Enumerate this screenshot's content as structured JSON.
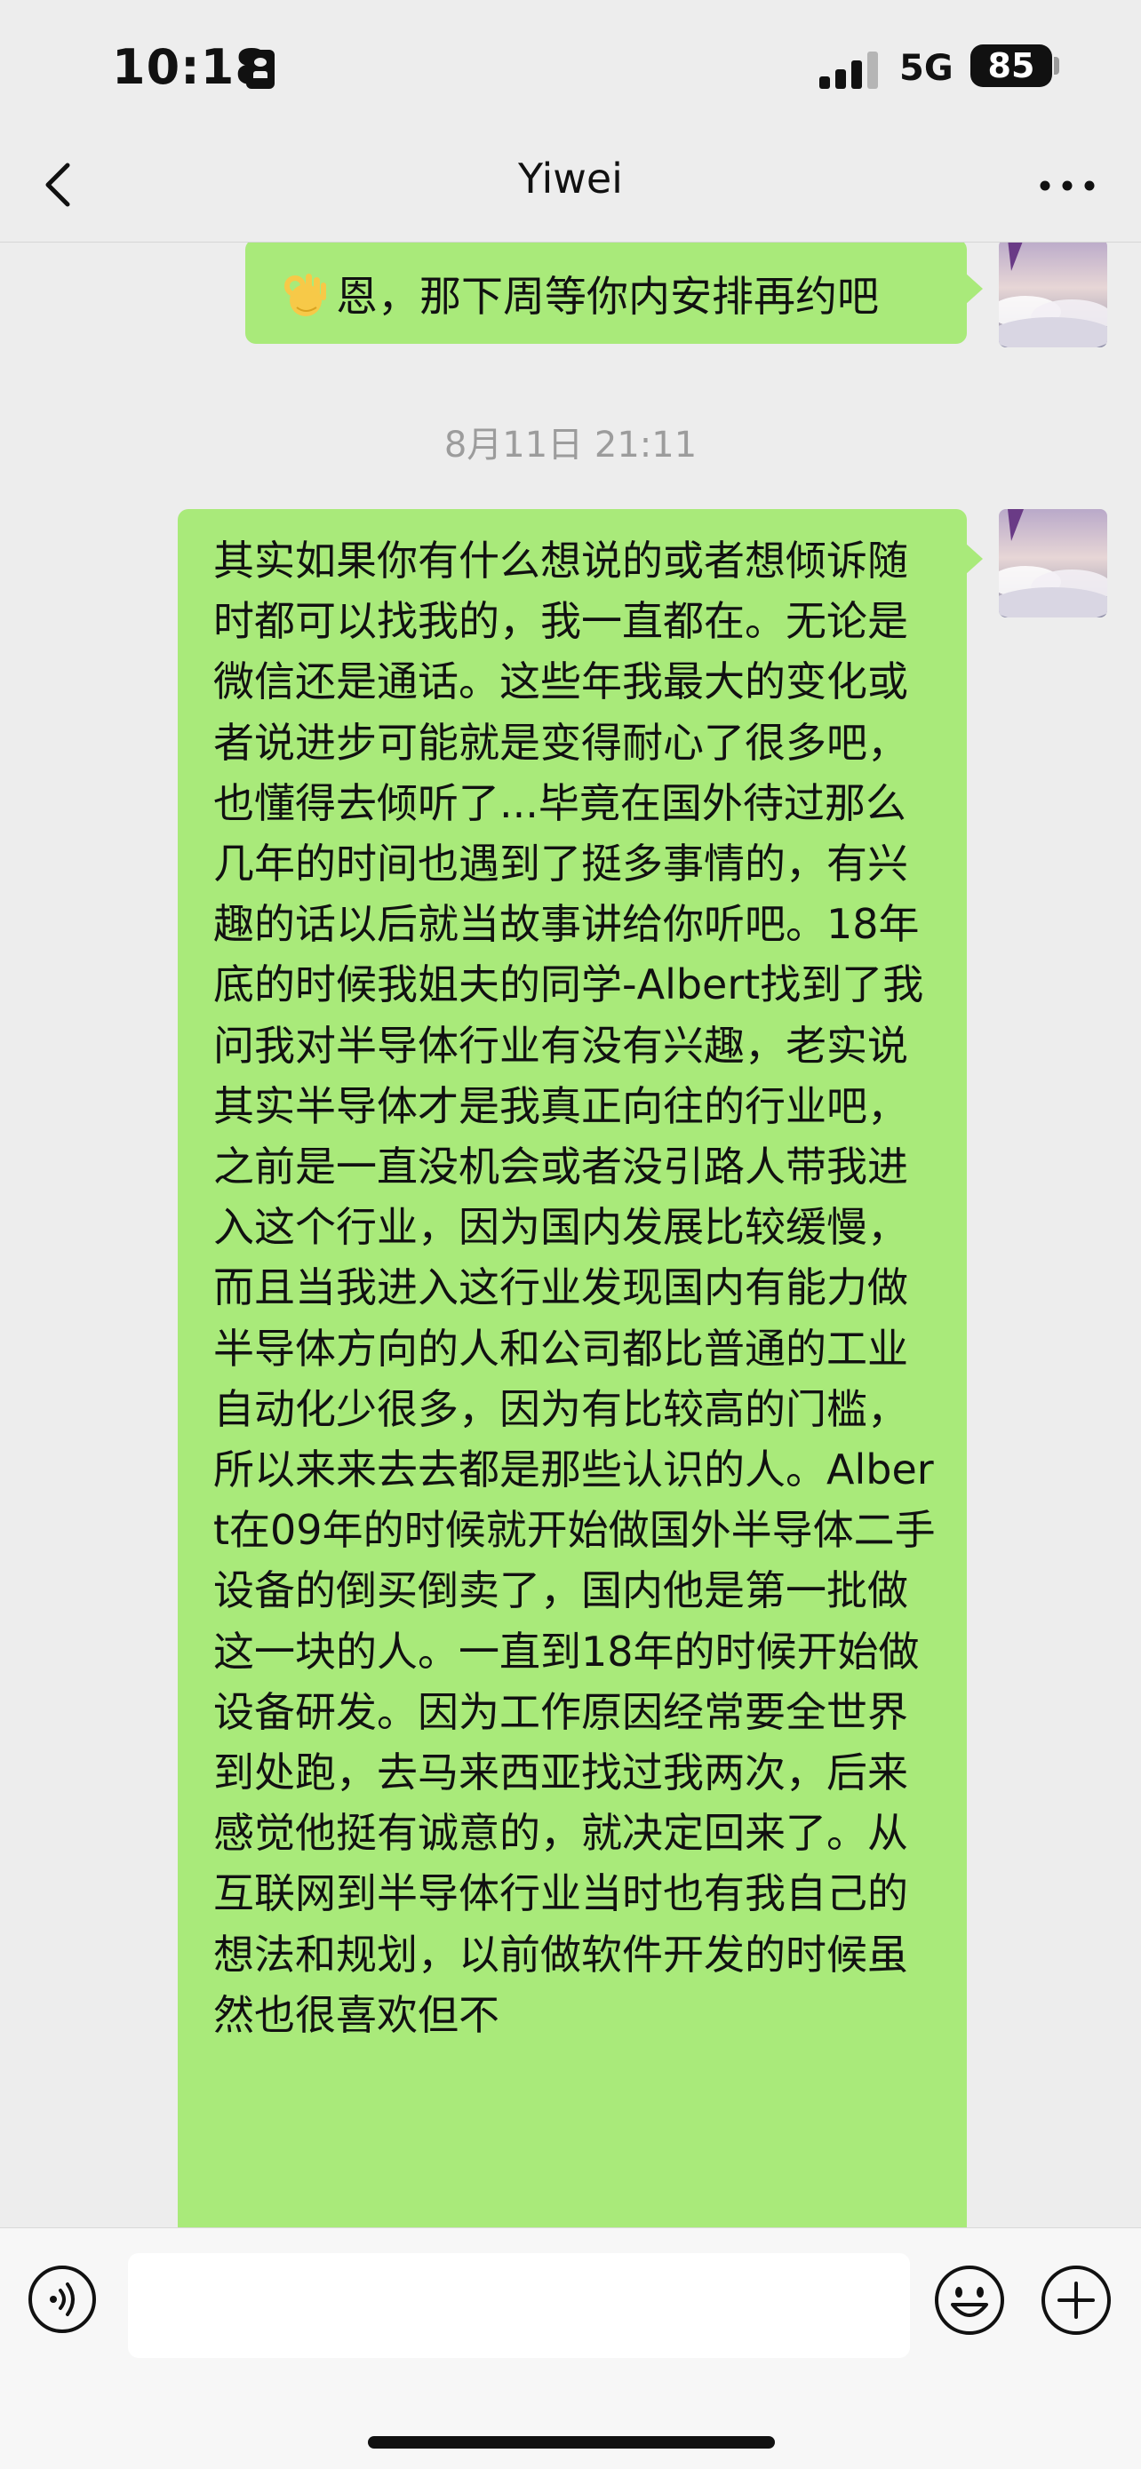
{
  "status_bar": {
    "time": "10:18",
    "network": "5G",
    "battery": "85"
  },
  "nav": {
    "title": "Yiwei",
    "back_icon": "chevron-left-icon",
    "more_icon": "more-dots-icon"
  },
  "messages": [
    {
      "type": "sent",
      "emoji_icon": "ok-hand-icon",
      "text": "恩，那下周等你内安排再约吧"
    },
    {
      "type": "timestamp",
      "text": "8月11日 21:11"
    },
    {
      "type": "sent",
      "text": "其实如果你有什么想说的或者想倾诉随时都可以找我的，我一直都在。无论是微信还是通话。这些年我最大的变化或者说进步可能就是变得耐心了很多吧，也懂得去倾听了...毕竟在国外待过那么几年的时间也遇到了挺多事情的，有兴趣的话以后就当故事讲给你听吧。18年底的时候我姐夫的同学-Albert找到了我问我对半导体行业有没有兴趣，老实说其实半导体才是我真正向往的行业吧，之前是一直没机会或者没引路人带我进入这个行业，因为国内发展比较缓慢，而且当我进入这行业发现国内有能力做半导体方向的人和公司都比普通的工业自动化少很多，因为有比较高的门槛，所以来来去去都是那些认识的人。Albert在09年的时候就开始做国外半导体二手设备的倒买倒卖了，国内他是第一批做这一块的人。一直到18年的时候开始做设备研发。因为工作原因经常要全世界到处跑，去马来西亚找过我两次，后来感觉他挺有诚意的，就决定回来了。从互联网到半导体行业当时也有我自己的想法和规划，以前做软件开发的时候虽然也很喜欢但不"
    }
  ],
  "input_bar": {
    "voice_icon": "voice-icon",
    "emoji_icon": "emoji-icon",
    "plus_icon": "plus-icon",
    "input_value": ""
  },
  "colors": {
    "background": "#ededed",
    "sent_bubble": "#a9ea7a",
    "timestamp_text": "#9c9c9c"
  }
}
